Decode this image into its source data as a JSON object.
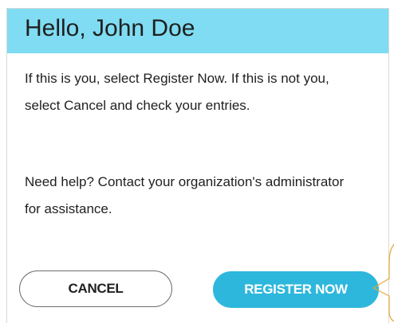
{
  "dialog": {
    "title": "Hello, John Doe",
    "paragraph_1": "If this is you, select Register Now. If this is not you, select Cancel and check your entries.",
    "paragraph_2": "Need help? Contact your organization's administrator for assistance.",
    "cancel_label": "CANCEL",
    "register_label": "REGISTER NOW"
  },
  "colors": {
    "header_bg": "#7fdcf2",
    "primary_button": "#2eb7dc",
    "callout_outline": "#e5a93a"
  }
}
